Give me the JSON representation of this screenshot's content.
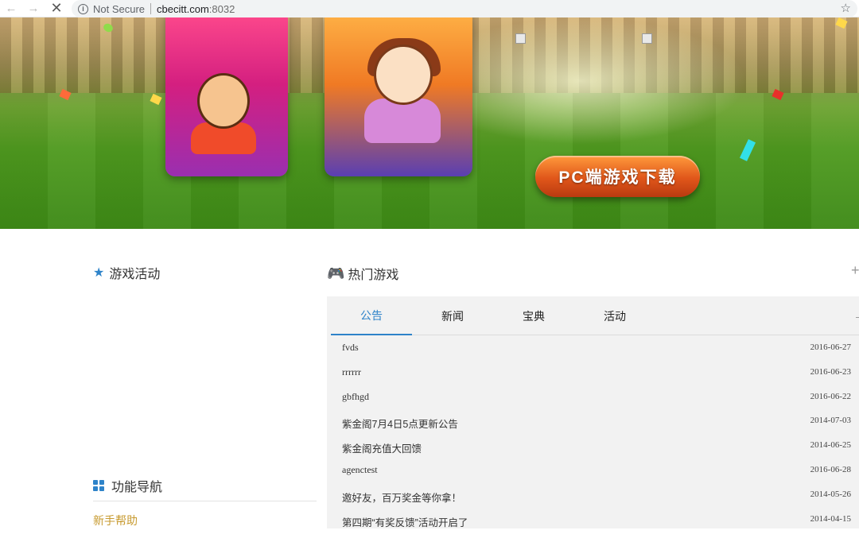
{
  "browser": {
    "back_icon": "←",
    "forward_icon": "→",
    "stop_icon": "✕",
    "info_icon": "i",
    "security_label": "Not Secure",
    "url_host": "cbecitt.com",
    "url_port": ":8032",
    "bookmark_icon": "☆"
  },
  "banner": {
    "download_button": "PC端游戏下载"
  },
  "left": {
    "activity_title": "游戏活动",
    "nav_title": "功能导航",
    "help_link": "新手帮助"
  },
  "hot_games": {
    "title": "热门游戏",
    "plus_icon": "+"
  },
  "news": {
    "tabs": [
      {
        "label": "公告"
      },
      {
        "label": "新闻"
      },
      {
        "label": "宝典"
      },
      {
        "label": "活动"
      }
    ],
    "active_tab": "公告",
    "items": [
      {
        "title": "fvds",
        "date": "2016-06-27"
      },
      {
        "title": "rrrrrr",
        "date": "2016-06-23"
      },
      {
        "title": "gbfhgd",
        "date": "2016-06-22"
      },
      {
        "title": "紫金阁7月4日5点更新公告",
        "date": "2014-07-03"
      },
      {
        "title": "紫金阁充值大回馈",
        "date": "2014-06-25"
      },
      {
        "title": "agenctest",
        "date": "2016-06-28"
      },
      {
        "title": "邀好友，百万奖金等你拿！",
        "date": "2014-05-26"
      },
      {
        "title": "第四期“有奖反馈”活动开启了",
        "date": "2014-04-15"
      }
    ]
  },
  "colors": {
    "accent_blue": "#2e83c9",
    "link_gold": "#c79a2f",
    "panel_bg": "#f2f2f2"
  }
}
